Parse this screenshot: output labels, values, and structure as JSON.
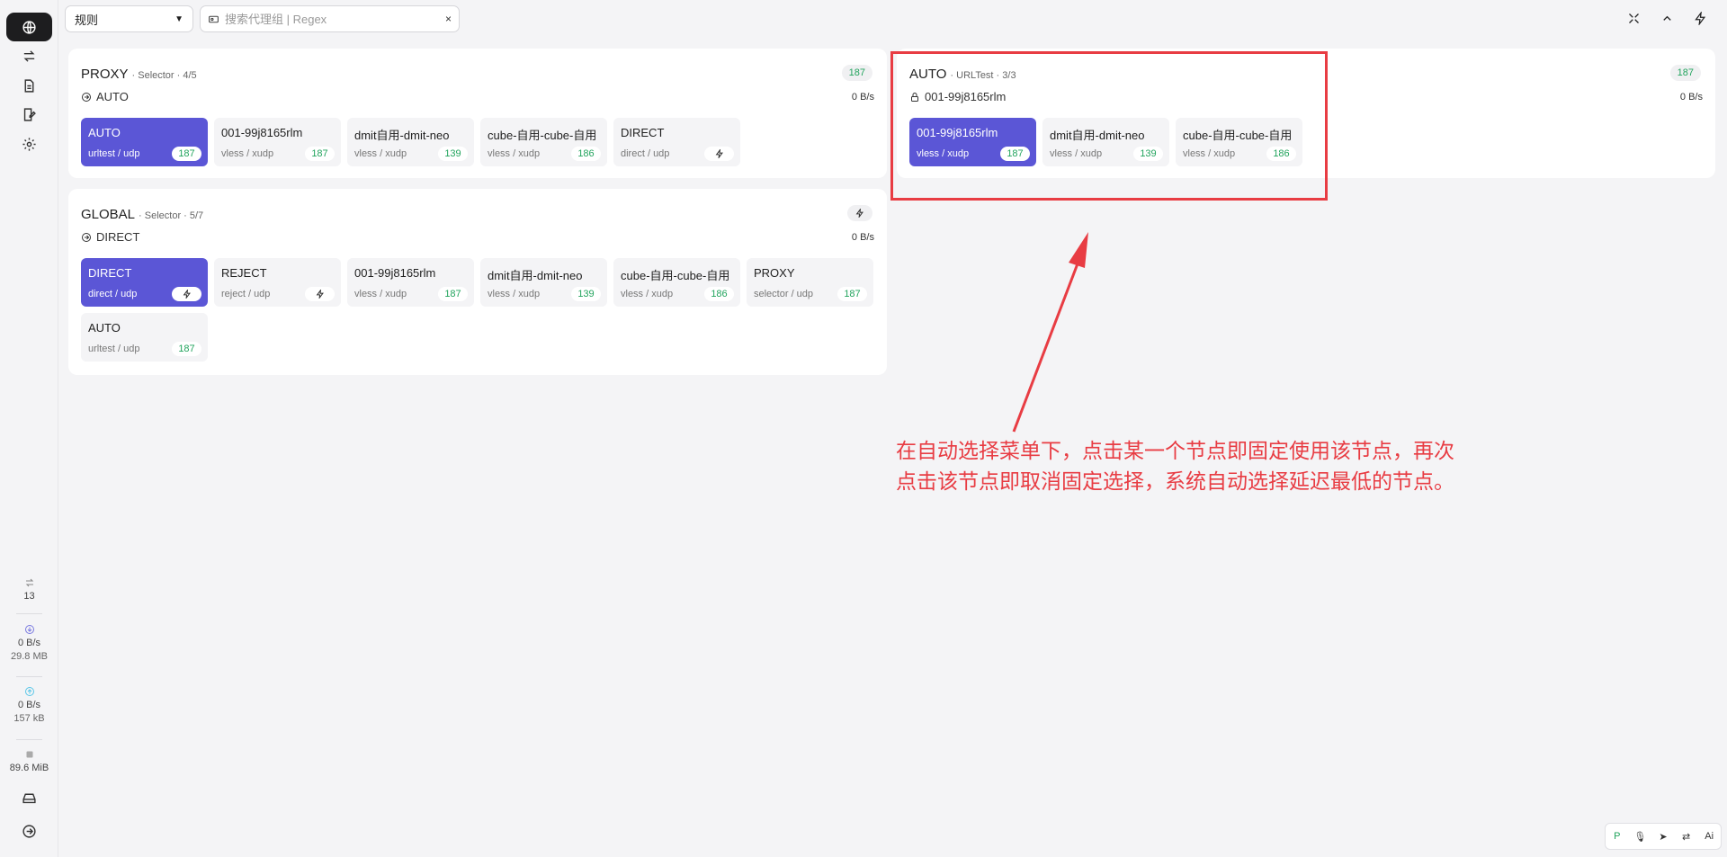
{
  "sidebar": {
    "connections": "13",
    "download_rate": "0 B/s",
    "download_total": "29.8 MB",
    "upload_rate": "0 B/s",
    "upload_total": "157 kB",
    "memory": "89.6 MiB"
  },
  "toolbar": {
    "mode": "规则",
    "search_placeholder": "搜索代理组 | Regex",
    "clear": "×"
  },
  "groups": {
    "proxy": {
      "name": "PROXY",
      "meta": "· Selector · 4/5",
      "now": "AUTO",
      "badge": "187",
      "speed": "0 B/s",
      "nodes": [
        {
          "name": "AUTO",
          "type": "urltest / udp",
          "latency": "187"
        },
        {
          "name": "001-99j8165rlm",
          "type": "vless / xudp",
          "latency": "187"
        },
        {
          "name": "dmit自用-dmit-neo",
          "type": "vless / xudp",
          "latency": "139"
        },
        {
          "name": "cube-自用-cube-自用",
          "type": "vless / xudp",
          "latency": "186"
        },
        {
          "name": "DIRECT",
          "type": "direct / udp",
          "latency": ""
        }
      ]
    },
    "auto": {
      "name": "AUTO",
      "meta": "· URLTest · 3/3",
      "now": "001-99j8165rlm",
      "badge": "187",
      "speed": "0 B/s",
      "nodes": [
        {
          "name": "001-99j8165rlm",
          "type": "vless / xudp",
          "latency": "187"
        },
        {
          "name": "dmit自用-dmit-neo",
          "type": "vless / xudp",
          "latency": "139"
        },
        {
          "name": "cube-自用-cube-自用",
          "type": "vless / xudp",
          "latency": "186"
        }
      ]
    },
    "global": {
      "name": "GLOBAL",
      "meta": "· Selector · 5/7",
      "now": "DIRECT",
      "speed": "0 B/s",
      "nodes": [
        {
          "name": "DIRECT",
          "type": "direct / udp",
          "latency": ""
        },
        {
          "name": "REJECT",
          "type": "reject / udp",
          "latency": ""
        },
        {
          "name": "001-99j8165rlm",
          "type": "vless / xudp",
          "latency": "187"
        },
        {
          "name": "dmit自用-dmit-neo",
          "type": "vless / xudp",
          "latency": "139"
        },
        {
          "name": "cube-自用-cube-自用",
          "type": "vless / xudp",
          "latency": "186"
        },
        {
          "name": "PROXY",
          "type": "selector / udp",
          "latency": "187"
        },
        {
          "name": "AUTO",
          "type": "urltest / udp",
          "latency": "187"
        }
      ]
    }
  },
  "annotation": {
    "line1": "在自动选择菜单下，点击某一个节点即固定使用该节点，再次",
    "line2": "点击该节点即取消固定选择，系统自动选择延迟最低的节点。",
    "color": "#e83c43"
  },
  "tray": {
    "ai_label": "Ai"
  },
  "colors": {
    "accent": "#5b56d6",
    "latency_good": "#22a45d"
  }
}
